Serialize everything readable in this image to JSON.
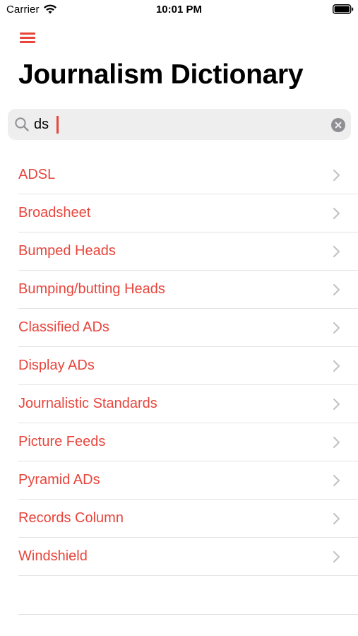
{
  "status_bar": {
    "carrier": "Carrier",
    "time": "10:01 PM"
  },
  "header": {
    "menu_icon": "hamburger-menu-icon",
    "title": "Journalism Dictionary"
  },
  "search": {
    "value": "ds",
    "search_icon": "magnifying-glass-icon",
    "clear_icon": "clear-x-circle-icon"
  },
  "results": [
    {
      "label": "ADSL"
    },
    {
      "label": "Broadsheet"
    },
    {
      "label": "Bumped Heads"
    },
    {
      "label": "Bumping/butting Heads"
    },
    {
      "label": "Classified ADs"
    },
    {
      "label": "Display ADs"
    },
    {
      "label": "Journalistic Standards"
    },
    {
      "label": "Picture Feeds"
    },
    {
      "label": "Pyramid ADs"
    },
    {
      "label": "Records Column"
    },
    {
      "label": "Windshield"
    }
  ],
  "colors": {
    "accent": "#e8453c",
    "search_background": "#eeeeef",
    "divider": "#e3e3e6",
    "chevron": "#c4c4c7"
  }
}
